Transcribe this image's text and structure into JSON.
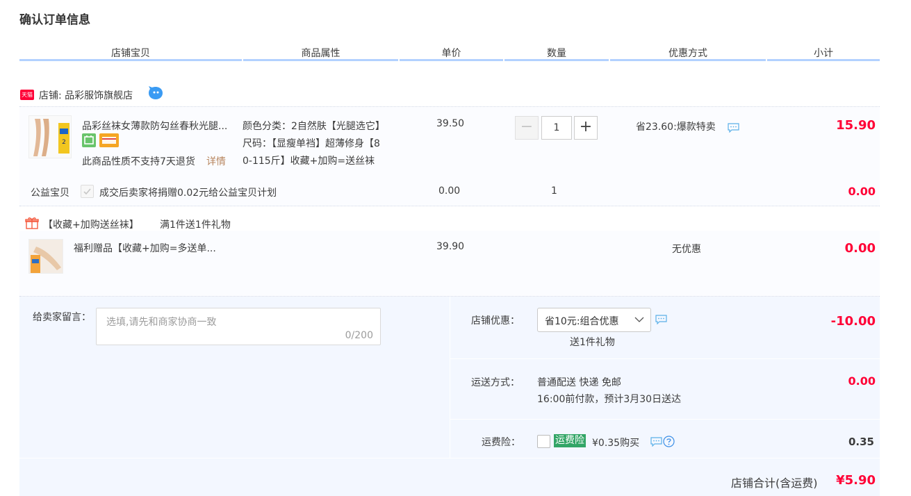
{
  "page": {
    "title": "确认订单信息"
  },
  "columns": [
    "店铺宝贝",
    "商品属性",
    "单价",
    "数量",
    "优惠方式",
    "小计"
  ],
  "shop": {
    "badge": "天猫",
    "label": "店铺: 品彩服饰旗舰店"
  },
  "item": {
    "title": "品彩丝袜女薄款防勾丝春秋光腿...",
    "no_return": "此商品性质不支持7天退货",
    "detail_link": "详情",
    "attr_color": "颜色分类：2自然肤【光腿选它】",
    "attr_size_1": "尺码：【显瘦单裆】超薄修身【8",
    "attr_size_2": "0-115斤】收藏+加购=送丝袜",
    "price": "39.50",
    "quantity": "1",
    "minus": "−",
    "plus": "+",
    "discount": "省23.60:爆款特卖",
    "subtotal": "15.90"
  },
  "charity": {
    "label": "公益宝贝",
    "text": "成交后卖家将捐赠0.02元给公益宝贝计划",
    "price": "0.00",
    "quantity": "1",
    "subtotal": "0.00"
  },
  "gift_promo": {
    "name": "【收藏+加购送丝袜】",
    "rule": "满1件送1件礼物"
  },
  "gift_item": {
    "title": "福利赠品【收藏+加购=多送单...",
    "price": "39.90",
    "discount": "无优惠",
    "subtotal": "0.00"
  },
  "message": {
    "label": "给卖家留言：",
    "placeholder": "选填,请先和商家协商一致",
    "counter": "0/200"
  },
  "shop_discount": {
    "label": "店铺优惠：",
    "selected": "省10元:组合优惠",
    "gift_note": "送1件礼物",
    "amount": "-10.00"
  },
  "shipping": {
    "label": "运送方式：",
    "method": "普通配送 快递 免邮",
    "eta": "16:00前付款，预计3月30日送达",
    "amount": "0.00"
  },
  "insurance": {
    "label": "运费险：",
    "tag": "运费险",
    "text": "¥0.35购买",
    "amount": "0.35"
  },
  "total": {
    "label": "店铺合计(含运费)",
    "amount": "¥5.90"
  },
  "colors": {
    "accent_red": "#ff0036",
    "header_line": "#b2d1ff",
    "panel_bg": "#f3f7ff",
    "insurance_green": "#32a566"
  }
}
